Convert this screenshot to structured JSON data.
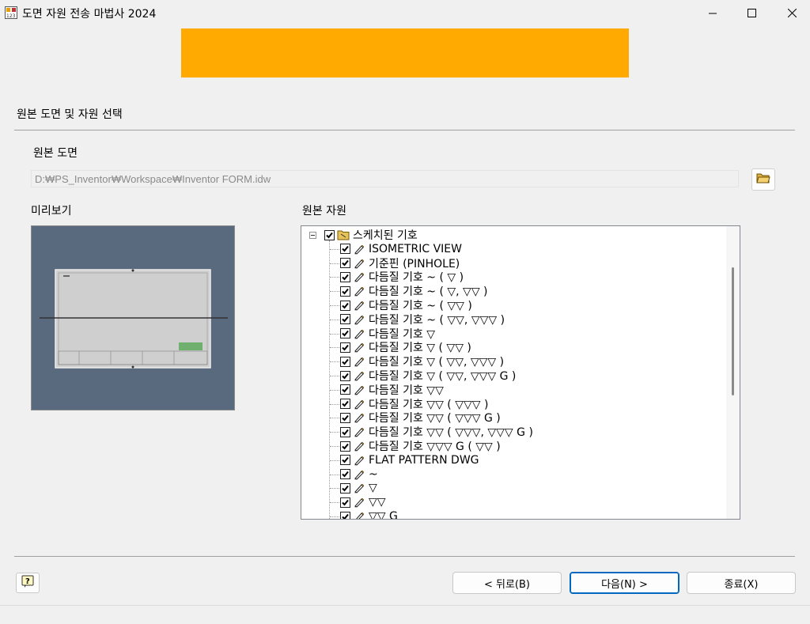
{
  "window": {
    "title": "도면 자원 전송 마법사 2024",
    "icon": "app-grid-icon",
    "controls": [
      "minimize-icon",
      "maximize-icon",
      "close-icon"
    ]
  },
  "banner": {
    "color": "#ffaa00"
  },
  "section_title": "원본 도면 및 자원 선택",
  "source_drawing": {
    "label": "원본 도면",
    "path": "D:₩PS_Inventor₩Workspace₩Inventor FORM.idw",
    "browse_icon": "open-folder-icon"
  },
  "preview": {
    "label": "미리보기"
  },
  "resources": {
    "label": "원본 자원",
    "root": {
      "label": "스케치된 기호",
      "checked": true,
      "expanded": true
    },
    "items": [
      {
        "label": "ISOMETRIC VIEW",
        "checked": true
      },
      {
        "label": "기준핀 (PINHOLE)",
        "checked": true
      },
      {
        "label": "다듬질 기호 ~ ( ▽ )",
        "checked": true
      },
      {
        "label": "다듬질 기호 ~ ( ▽, ▽▽ )",
        "checked": true
      },
      {
        "label": "다듬질 기호 ~ ( ▽▽ )",
        "checked": true
      },
      {
        "label": "다듬질 기호 ~ ( ▽▽, ▽▽▽ )",
        "checked": true
      },
      {
        "label": "다듬질 기호 ▽",
        "checked": true
      },
      {
        "label": "다듬질 기호 ▽ ( ▽▽ )",
        "checked": true
      },
      {
        "label": "다듬질 기호 ▽ ( ▽▽, ▽▽▽ )",
        "checked": true
      },
      {
        "label": "다듬질 기호 ▽ ( ▽▽, ▽▽▽ G )",
        "checked": true
      },
      {
        "label": "다듬질 기호 ▽▽",
        "checked": true
      },
      {
        "label": "다듬질 기호 ▽▽ ( ▽▽▽ )",
        "checked": true
      },
      {
        "label": "다듬질 기호 ▽▽ ( ▽▽▽ G )",
        "checked": true
      },
      {
        "label": "다듬질 기호 ▽▽ ( ▽▽▽, ▽▽▽ G )",
        "checked": true
      },
      {
        "label": "다듬질 기호 ▽▽▽ G ( ▽▽ )",
        "checked": true
      },
      {
        "label": "FLAT PATTERN DWG",
        "checked": true
      },
      {
        "label": "~",
        "checked": true
      },
      {
        "label": "▽",
        "checked": true
      },
      {
        "label": "▽▽",
        "checked": true
      },
      {
        "label": "▽▽ G",
        "checked": true
      }
    ]
  },
  "buttons": {
    "help_icon": "help-icon",
    "back": "< 뒤로(B)",
    "next": "다음(N) >",
    "finish": "종료(X)"
  }
}
